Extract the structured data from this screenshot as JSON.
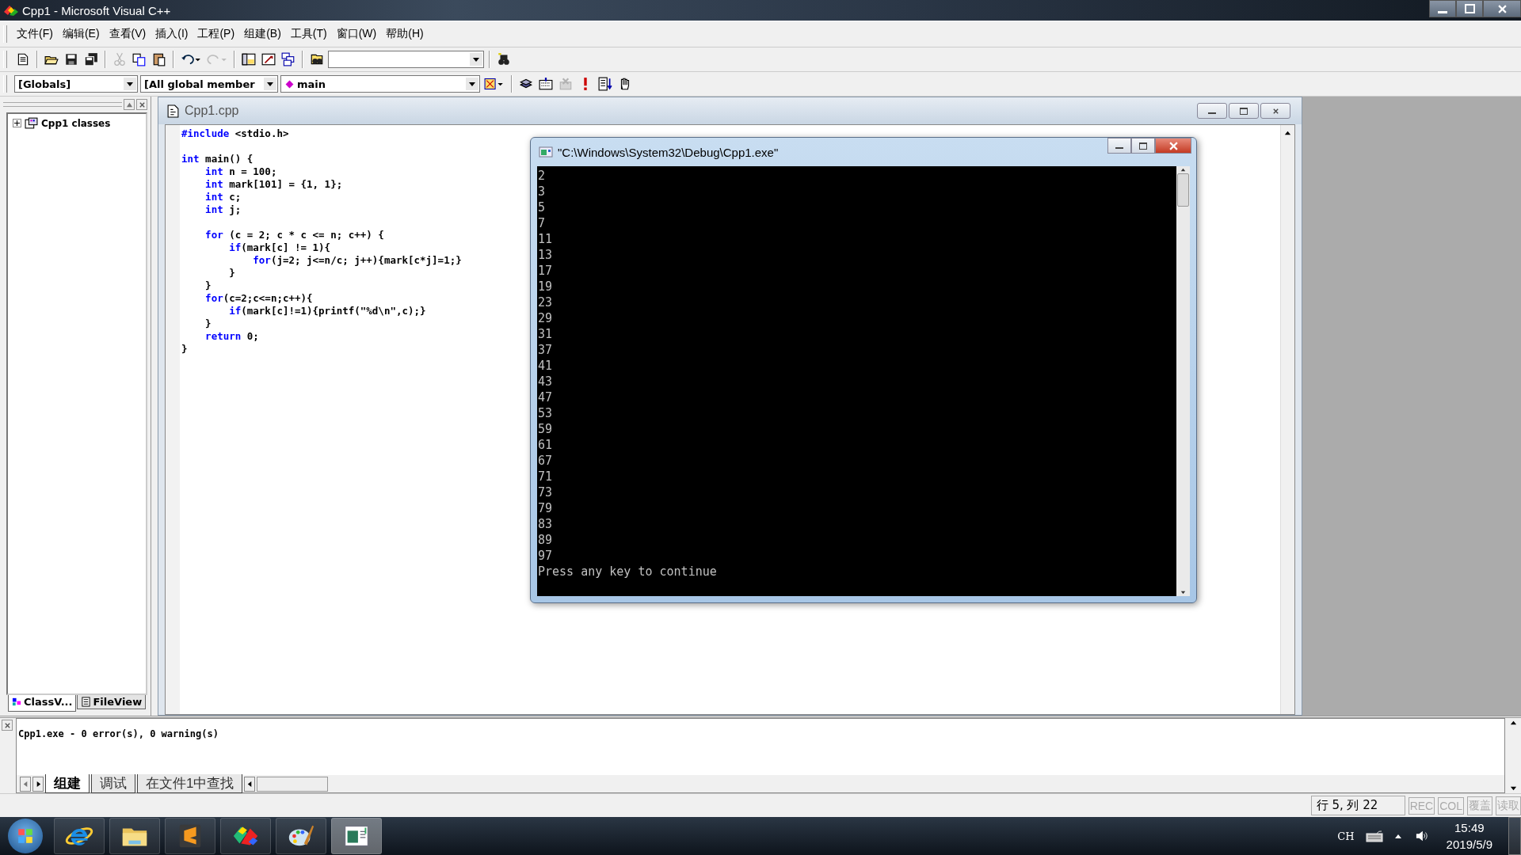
{
  "window": {
    "title": "Cpp1 - Microsoft Visual C++"
  },
  "menu": [
    "文件(F)",
    "编辑(E)",
    "查看(V)",
    "插入(I)",
    "工程(P)",
    "组建(B)",
    "工具(T)",
    "窗口(W)",
    "帮助(H)"
  ],
  "wizard_bar": {
    "scope": "[Globals]",
    "filter": "[All global member",
    "member": "main"
  },
  "workspace": {
    "tree": [
      {
        "label": "Cpp1 classes",
        "expanded": false
      }
    ],
    "tabs": [
      {
        "label": "ClassV...",
        "selected": true
      },
      {
        "label": "FileView",
        "selected": false
      }
    ]
  },
  "editor": {
    "title": "Cpp1.cpp",
    "lines": [
      {
        "kind": "code",
        "tokens": [
          {
            "text": "#include",
            "kind": "keyword"
          },
          {
            "text": " <stdio.h>",
            "kind": "plain"
          }
        ]
      },
      {
        "kind": "blank"
      },
      {
        "kind": "code",
        "tokens": [
          {
            "text": "int",
            "kind": "keyword"
          },
          {
            "text": " main() {",
            "kind": "plain"
          }
        ]
      },
      {
        "kind": "code",
        "tokens": [
          {
            "text": "    int",
            "kind": "keyword"
          },
          {
            "text": " n = 100;",
            "kind": "plain"
          }
        ]
      },
      {
        "kind": "code",
        "tokens": [
          {
            "text": "    int",
            "kind": "keyword"
          },
          {
            "text": " mark[101] = {1, 1};",
            "kind": "plain"
          }
        ]
      },
      {
        "kind": "code",
        "tokens": [
          {
            "text": "    int",
            "kind": "keyword"
          },
          {
            "text": " c;",
            "kind": "plain"
          }
        ]
      },
      {
        "kind": "code",
        "tokens": [
          {
            "text": "    int",
            "kind": "keyword"
          },
          {
            "text": " j;",
            "kind": "plain"
          }
        ]
      },
      {
        "kind": "blank"
      },
      {
        "kind": "code",
        "tokens": [
          {
            "text": "    for",
            "kind": "keyword"
          },
          {
            "text": " (c = 2; c * c <= n; c++) {",
            "kind": "plain"
          }
        ]
      },
      {
        "kind": "code",
        "tokens": [
          {
            "text": "        if",
            "kind": "keyword"
          },
          {
            "text": "(mark[c] != 1){",
            "kind": "plain"
          }
        ]
      },
      {
        "kind": "code",
        "tokens": [
          {
            "text": "            for",
            "kind": "keyword"
          },
          {
            "text": "(j=2; j<=n/c; j++){mark[c*j]=1;}",
            "kind": "plain"
          }
        ]
      },
      {
        "kind": "code",
        "tokens": [
          {
            "text": "        }",
            "kind": "plain"
          }
        ]
      },
      {
        "kind": "code",
        "tokens": [
          {
            "text": "    }",
            "kind": "plain"
          }
        ]
      },
      {
        "kind": "code",
        "tokens": [
          {
            "text": "    for",
            "kind": "keyword"
          },
          {
            "text": "(c=2;c<=n;c++){",
            "kind": "plain"
          }
        ]
      },
      {
        "kind": "code",
        "tokens": [
          {
            "text": "        if",
            "kind": "keyword"
          },
          {
            "text": "(mark[c]!=1){printf(\"%d\\n\",c);}",
            "kind": "plain"
          }
        ]
      },
      {
        "kind": "code",
        "tokens": [
          {
            "text": "    }",
            "kind": "plain"
          }
        ]
      },
      {
        "kind": "code",
        "tokens": [
          {
            "text": "    return",
            "kind": "keyword"
          },
          {
            "text": " 0;",
            "kind": "plain"
          }
        ]
      },
      {
        "kind": "code",
        "tokens": [
          {
            "text": "}",
            "kind": "plain"
          }
        ]
      }
    ]
  },
  "console": {
    "title": "\"C:\\Windows\\System32\\Debug\\Cpp1.exe\"",
    "lines": [
      "2",
      "3",
      "5",
      "7",
      "11",
      "13",
      "17",
      "19",
      "23",
      "29",
      "31",
      "37",
      "41",
      "43",
      "47",
      "53",
      "59",
      "61",
      "67",
      "71",
      "73",
      "79",
      "83",
      "89",
      "97",
      "Press any key to continue"
    ]
  },
  "output": {
    "text": "Cpp1.exe - 0 error(s), 0 warning(s)",
    "tabs": [
      {
        "label": "组建",
        "selected": true
      },
      {
        "label": "调试",
        "selected": false
      },
      {
        "label": "在文件1中查找",
        "selected": false
      }
    ]
  },
  "status_bar": {
    "position": "行 5, 列 22",
    "indicators": [
      {
        "label": "REC",
        "disabled": true
      },
      {
        "label": "COL",
        "disabled": true
      },
      {
        "label": "覆盖",
        "disabled": true
      },
      {
        "label": "读取",
        "disabled": true
      }
    ]
  },
  "taskbar": {
    "language": "CH",
    "time": "15:49",
    "date": "2019/5/9"
  }
}
